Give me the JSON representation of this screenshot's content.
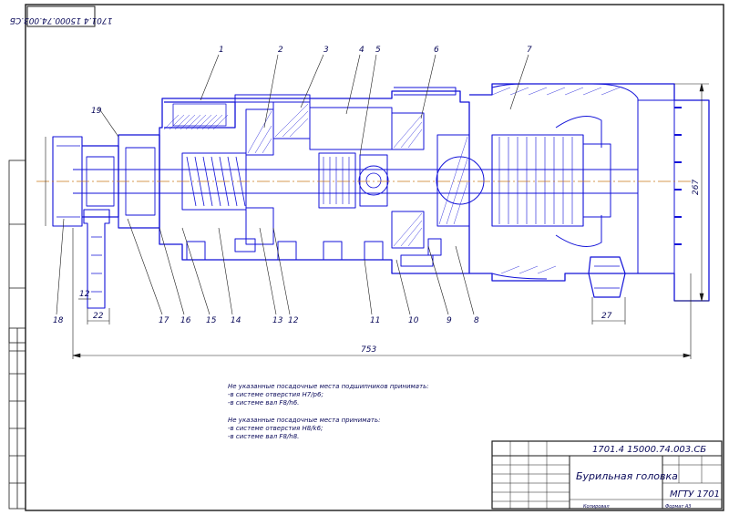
{
  "drawing": {
    "code_top_left": "1701.4 15000.74.003.СБ",
    "part_callouts": [
      "1",
      "2",
      "3",
      "4",
      "5",
      "6",
      "7",
      "8",
      "9",
      "10",
      "11",
      "12",
      "13",
      "14",
      "15",
      "16",
      "17",
      "18",
      "19"
    ],
    "dimensions": {
      "overall_length": "753",
      "height_right": "267",
      "d1": "22",
      "d2": "12",
      "d3": "27"
    },
    "colors": {
      "line": "#1212d8",
      "frame": "#1a1a1a",
      "center_line": "#c87a1a",
      "text": "#0a0a5a"
    }
  },
  "notes": [
    "Не указанные посадочные места подшипников принимать:",
    "-в системе отверстия Н7/p6;",
    "-в системе вал F8/h6.",
    "Не указанные посадочные места принимать:",
    "-в системе отверстия Н8/k6;",
    "-в системе вал F8/h8."
  ],
  "title_block": {
    "document_code": "1701.4 15000.74.003.СБ",
    "title": "Бурильная головка",
    "org": "МГТУ 1701",
    "copied": "Копировал",
    "format": "Формат А3"
  }
}
